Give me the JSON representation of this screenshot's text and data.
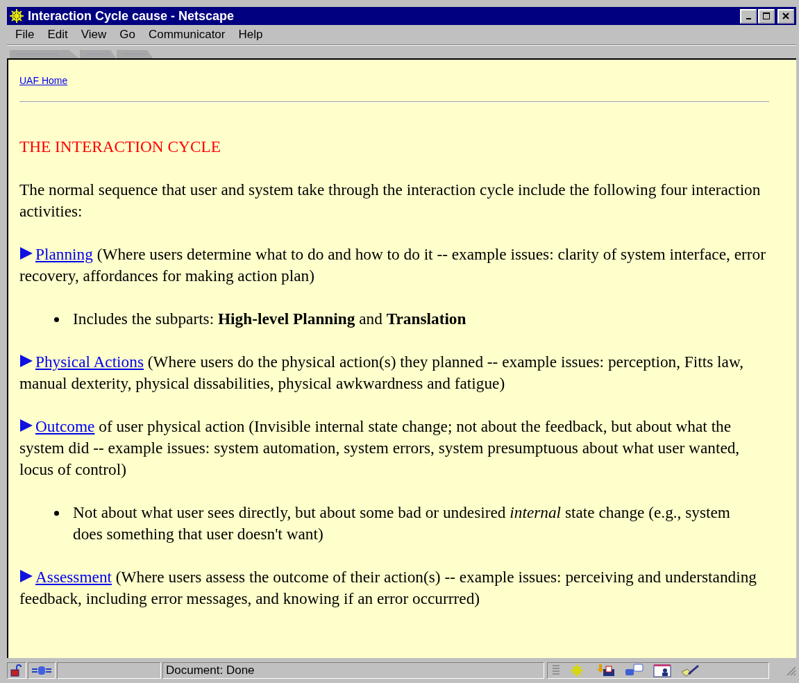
{
  "window": {
    "title": "Interaction Cycle cause - Netscape"
  },
  "menu": [
    "File",
    "Edit",
    "View",
    "Go",
    "Communicator",
    "Help"
  ],
  "page": {
    "home_link": "UAF Home",
    "heading": "THE INTERACTION CYCLE",
    "intro": "The normal sequence that user and system take through the interaction cycle include the following four interaction activities:",
    "sections": [
      {
        "kind": "item",
        "link": "Planning",
        "text": " (Where users determine what to do and how to do it -- example issues: clarity of system interface, error recovery, affordances for making action plan)"
      },
      {
        "kind": "bullet",
        "text": "Includes the subparts: **High-level Planning** and **Translation**"
      },
      {
        "kind": "item",
        "link": "Physical Actions",
        "text": " (Where users do the physical action(s) they planned -- example issues: perception, Fitts law, manual dexterity, physical dissabilities, physical awkwardness and fatigue)"
      },
      {
        "kind": "item",
        "link": "Outcome",
        "text": " of user physical action (Invisible internal state change; not about the feedback, but about what the system did -- example issues: system automation, system errors, system presumptuous about what user wanted, locus of control)"
      },
      {
        "kind": "bullet",
        "text": "Not about what user sees directly, but about some bad or undesired *internal* state change (e.g., system does something that user doesn't want)"
      },
      {
        "kind": "item",
        "link": "Assessment",
        "text": " (Where users assess the outcome of their action(s) -- example issues: perceiving and understanding feedback, including error messages, and knowing if an error occurrred)"
      }
    ]
  },
  "status_bar": {
    "text": "Document: Done"
  }
}
